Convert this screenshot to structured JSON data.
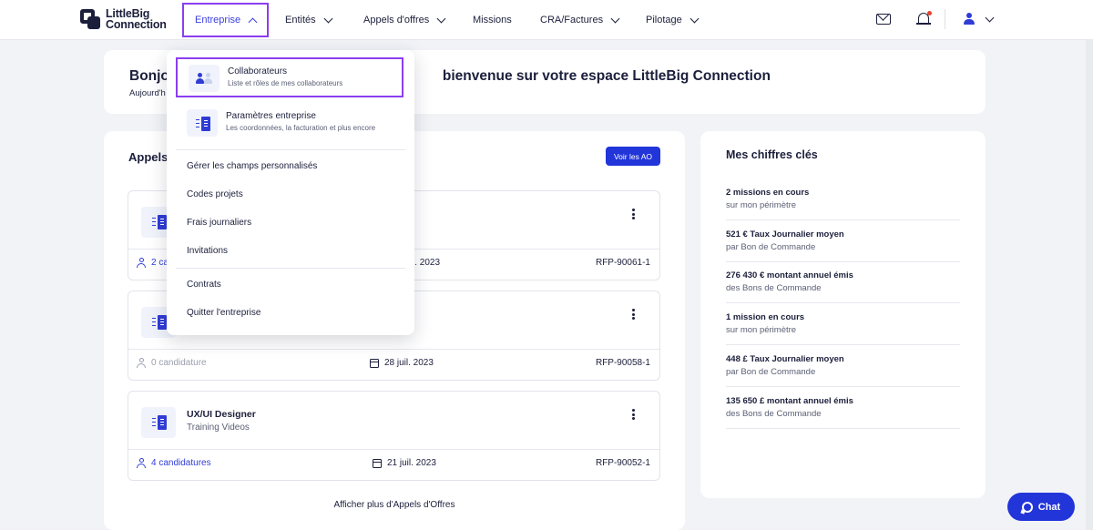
{
  "brand": {
    "line1": "LittleBig",
    "line2": "Connection"
  },
  "nav": {
    "items": [
      {
        "label": "Entreprise"
      },
      {
        "label": "Entités"
      },
      {
        "label": "Appels d'offres"
      },
      {
        "label": "Missions"
      },
      {
        "label": "CRA/Factures"
      },
      {
        "label": "Pilotage"
      }
    ]
  },
  "welcome": {
    "title_left": "Bonjo",
    "title_right": "bienvenue sur votre espace LittleBig Connection",
    "subtitle": "Aujourd'h"
  },
  "ao": {
    "heading": "Appels",
    "voir_label": "Voir les AO",
    "items": [
      {
        "name": "",
        "client": "",
        "candidates": "2 ca",
        "date": "l. 2023",
        "ref": "RFP-90061-1"
      },
      {
        "name": "",
        "client": "",
        "candidates": "0 candidature",
        "date": "28 juil. 2023",
        "ref": "RFP-90058-1"
      },
      {
        "name": "UX/UI Designer",
        "client": "Training Videos",
        "candidates": "4 candidatures",
        "date": "21 juil. 2023",
        "ref": "RFP-90052-1"
      }
    ],
    "more_label": "Afficher plus d'Appels d'Offres"
  },
  "kpis": {
    "heading": "Mes chiffres clés",
    "items": [
      {
        "value": "2 missions en cours",
        "label": "sur mon périmètre"
      },
      {
        "value": "521 € Taux Journalier moyen",
        "label": "par Bon de Commande"
      },
      {
        "value": "276 430 € montant annuel émis",
        "label": "des Bons de Commande"
      },
      {
        "value": "1 mission en cours",
        "label": "sur mon périmètre"
      },
      {
        "value": "448 £ Taux Journalier moyen",
        "label": "par Bon de Commande"
      },
      {
        "value": "135 650 £ montant annuel émis",
        "label": "des Bons de Commande"
      }
    ]
  },
  "dropdown": {
    "collab_title": "Collaborateurs",
    "collab_sub": "Liste et rôles de mes collaborateurs",
    "params_title": "Paramètres entreprise",
    "params_sub": "Les coordonnées, la facturation et plus encore",
    "items": [
      "Gérer les champs personnalisés",
      "Codes projets",
      "Frais journaliers",
      "Invitations",
      "Contrats",
      "Quitter l'entreprise"
    ]
  },
  "chat": {
    "label": "Chat"
  },
  "colors": {
    "primary": "#2235d9",
    "highlight": "#8b3ef0",
    "text": "#1b1f3b"
  }
}
